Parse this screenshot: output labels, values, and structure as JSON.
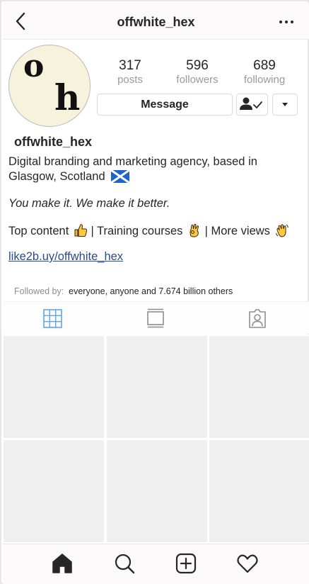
{
  "header": {
    "title": "offwhite_hex",
    "back_icon": "chevron-left-icon",
    "more_icon": "more-dots-icon"
  },
  "avatar": {
    "letter_1": "o",
    "letter_2": "h",
    "background_color": "#f7f2dc"
  },
  "stats": [
    {
      "value": "317",
      "label": "posts"
    },
    {
      "value": "596",
      "label": "followers"
    },
    {
      "value": "689",
      "label": "following"
    }
  ],
  "actions": {
    "message_label": "Message",
    "follow_icon": "person-check-icon",
    "dropdown_icon": "caret-down-icon"
  },
  "profile": {
    "username": "offwhite_hex",
    "bio_line1": "Digital branding and marketing agency, based in Glasgow, Scotland",
    "bio_line2": "You make it. We make it better.",
    "bio_line3_part1": "Top content",
    "bio_line3_part2": " | Training courses",
    "bio_line3_part3": " | More views",
    "link": "like2b.uy/offwhite_hex",
    "link_color": "#2b4a8a"
  },
  "followed_by": {
    "label": "Followed by:",
    "value": "everyone, anyone and 7.674 billion others"
  },
  "tabs": {
    "grid_icon": "grid-icon",
    "feed_icon": "feed-icon",
    "tagged_icon": "tagged-person-icon",
    "active_color": "#5fa6e8"
  },
  "bottom_nav": {
    "home_icon": "home-icon",
    "search_icon": "search-icon",
    "add_icon": "add-post-icon",
    "heart_icon": "heart-icon"
  }
}
